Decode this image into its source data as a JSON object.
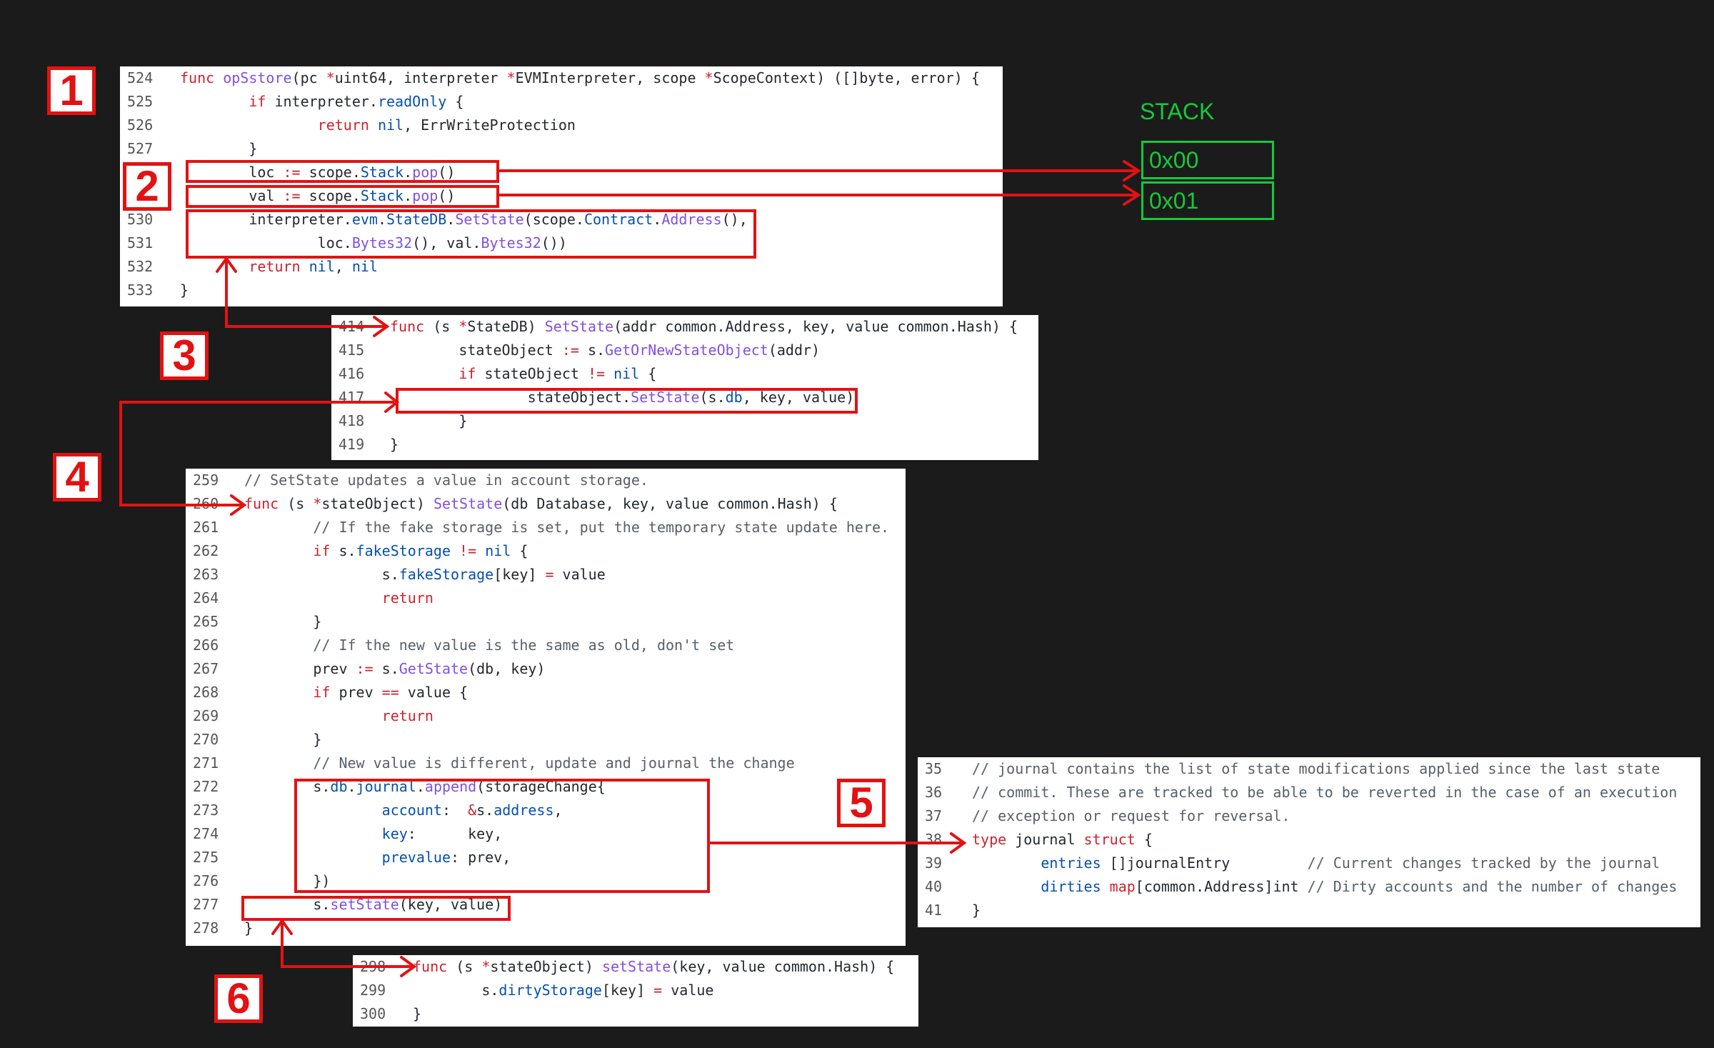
{
  "colors": {
    "background": "#1b1b1b",
    "annotation": "#e31212",
    "stack": "#17c93a"
  },
  "steps": [
    "1",
    "2",
    "3",
    "4",
    "5",
    "6"
  ],
  "stack": {
    "title": "STACK",
    "cells": [
      "0x00",
      "0x01"
    ]
  },
  "panels": [
    {
      "id": "opsstore",
      "lines": [
        {
          "n": "524",
          "t": [
            [
              "kw",
              "func "
            ],
            [
              "fn",
              "opSstore"
            ],
            [
              "",
              "(pc "
            ],
            [
              "kw",
              "*"
            ],
            [
              "",
              "uint64, interpreter "
            ],
            [
              "kw",
              "*"
            ],
            [
              "",
              "EVMInterpreter, scope "
            ],
            [
              "kw",
              "*"
            ],
            [
              "",
              "ScopeContext) ([]byte, error) {"
            ]
          ]
        },
        {
          "n": "525",
          "t": [
            [
              "",
              "        "
            ],
            [
              "kw",
              "if"
            ],
            [
              "",
              " interpreter."
            ],
            [
              "fd",
              "readOnly"
            ],
            [
              "",
              " {"
            ]
          ]
        },
        {
          "n": "526",
          "t": [
            [
              "",
              "                "
            ],
            [
              "kw",
              "return"
            ],
            [
              "",
              " "
            ],
            [
              "fd",
              "nil"
            ],
            [
              "",
              ", ErrWriteProtection"
            ]
          ]
        },
        {
          "n": "527",
          "t": [
            [
              "",
              "        }"
            ]
          ]
        },
        {
          "n": "528",
          "t": [
            [
              "",
              "        loc "
            ],
            [
              "kw",
              ":="
            ],
            [
              "",
              " scope."
            ],
            [
              "fd",
              "Stack"
            ],
            [
              "",
              "."
            ],
            [
              "fn",
              "pop"
            ],
            [
              "",
              "()"
            ]
          ]
        },
        {
          "n": "529",
          "t": [
            [
              "",
              "        val "
            ],
            [
              "kw",
              ":="
            ],
            [
              "",
              " scope."
            ],
            [
              "fd",
              "Stack"
            ],
            [
              "",
              "."
            ],
            [
              "fn",
              "pop"
            ],
            [
              "",
              "()"
            ]
          ]
        },
        {
          "n": "530",
          "t": [
            [
              "",
              "        interpreter."
            ],
            [
              "fd",
              "evm"
            ],
            [
              "",
              "."
            ],
            [
              "fd",
              "StateDB"
            ],
            [
              "",
              "."
            ],
            [
              "fn",
              "SetState"
            ],
            [
              "",
              "(scope."
            ],
            [
              "fd",
              "Contract"
            ],
            [
              "",
              "."
            ],
            [
              "fn",
              "Address"
            ],
            [
              "",
              "(),"
            ]
          ]
        },
        {
          "n": "531",
          "t": [
            [
              "",
              "                loc."
            ],
            [
              "fn",
              "Bytes32"
            ],
            [
              "",
              "(), val."
            ],
            [
              "fn",
              "Bytes32"
            ],
            [
              "",
              "())"
            ]
          ]
        },
        {
          "n": "532",
          "t": [
            [
              "",
              "        "
            ],
            [
              "kw",
              "return"
            ],
            [
              "",
              " "
            ],
            [
              "fd",
              "nil"
            ],
            [
              "",
              ", "
            ],
            [
              "fd",
              "nil"
            ]
          ]
        },
        {
          "n": "533",
          "t": [
            [
              "",
              "}"
            ]
          ]
        }
      ]
    },
    {
      "id": "statedb-setstate",
      "lines": [
        {
          "n": "414",
          "t": [
            [
              "kw",
              "func"
            ],
            [
              "",
              " (s "
            ],
            [
              "kw",
              "*"
            ],
            [
              "",
              "StateDB) "
            ],
            [
              "fn",
              "SetState"
            ],
            [
              "",
              "(addr common.Address, key, value common.Hash) {"
            ]
          ]
        },
        {
          "n": "415",
          "t": [
            [
              "",
              "        stateObject "
            ],
            [
              "kw",
              ":="
            ],
            [
              "",
              " s."
            ],
            [
              "fn",
              "GetOrNewStateObject"
            ],
            [
              "",
              "(addr)"
            ]
          ]
        },
        {
          "n": "416",
          "t": [
            [
              "",
              "        "
            ],
            [
              "kw",
              "if"
            ],
            [
              "",
              " stateObject "
            ],
            [
              "kw",
              "!="
            ],
            [
              "",
              " "
            ],
            [
              "fd",
              "nil"
            ],
            [
              "",
              " {"
            ]
          ]
        },
        {
          "n": "417",
          "t": [
            [
              "",
              "                stateObject."
            ],
            [
              "fn",
              "SetState"
            ],
            [
              "",
              "(s."
            ],
            [
              "fd",
              "db"
            ],
            [
              "",
              ", key, value)"
            ]
          ]
        },
        {
          "n": "418",
          "t": [
            [
              "",
              "        }"
            ]
          ]
        },
        {
          "n": "419",
          "t": [
            [
              "",
              "}"
            ]
          ]
        }
      ]
    },
    {
      "id": "stateobject-setstate",
      "lines": [
        {
          "n": "259",
          "t": [
            [
              "cm",
              "// SetState updates a value in account storage."
            ]
          ]
        },
        {
          "n": "260",
          "t": [
            [
              "kw",
              "func"
            ],
            [
              "",
              " (s "
            ],
            [
              "kw",
              "*"
            ],
            [
              "",
              "stateObject) "
            ],
            [
              "fn",
              "SetState"
            ],
            [
              "",
              "(db Database, key, value common.Hash) {"
            ]
          ]
        },
        {
          "n": "261",
          "t": [
            [
              "",
              "        "
            ],
            [
              "cm",
              "// If the fake storage is set, put the temporary state update here."
            ]
          ]
        },
        {
          "n": "262",
          "t": [
            [
              "",
              "        "
            ],
            [
              "kw",
              "if"
            ],
            [
              "",
              " s."
            ],
            [
              "fd",
              "fakeStorage"
            ],
            [
              "",
              " "
            ],
            [
              "kw",
              "!="
            ],
            [
              "",
              " "
            ],
            [
              "fd",
              "nil"
            ],
            [
              "",
              " {"
            ]
          ]
        },
        {
          "n": "263",
          "t": [
            [
              "",
              "                s."
            ],
            [
              "fd",
              "fakeStorage"
            ],
            [
              "",
              "[key] "
            ],
            [
              "kw",
              "="
            ],
            [
              "",
              " value"
            ]
          ]
        },
        {
          "n": "264",
          "t": [
            [
              "",
              "                "
            ],
            [
              "kw",
              "return"
            ]
          ]
        },
        {
          "n": "265",
          "t": [
            [
              "",
              "        }"
            ]
          ]
        },
        {
          "n": "266",
          "t": [
            [
              "",
              "        "
            ],
            [
              "cm",
              "// If the new value is the same as old, don't set"
            ]
          ]
        },
        {
          "n": "267",
          "t": [
            [
              "",
              "        prev "
            ],
            [
              "kw",
              ":="
            ],
            [
              "",
              " s."
            ],
            [
              "fn",
              "GetState"
            ],
            [
              "",
              "(db, key)"
            ]
          ]
        },
        {
          "n": "268",
          "t": [
            [
              "",
              "        "
            ],
            [
              "kw",
              "if"
            ],
            [
              "",
              " prev "
            ],
            [
              "kw",
              "=="
            ],
            [
              "",
              " value {"
            ]
          ]
        },
        {
          "n": "269",
          "t": [
            [
              "",
              "                "
            ],
            [
              "kw",
              "return"
            ]
          ]
        },
        {
          "n": "270",
          "t": [
            [
              "",
              "        }"
            ]
          ]
        },
        {
          "n": "271",
          "t": [
            [
              "",
              "        "
            ],
            [
              "cm",
              "// New value is different, update and journal the change"
            ]
          ]
        },
        {
          "n": "272",
          "t": [
            [
              "",
              "        s."
            ],
            [
              "fd",
              "db"
            ],
            [
              "",
              "."
            ],
            [
              "fd",
              "journal"
            ],
            [
              "",
              "."
            ],
            [
              "fn",
              "append"
            ],
            [
              "",
              "(storageChange{"
            ]
          ]
        },
        {
          "n": "273",
          "t": [
            [
              "",
              "                "
            ],
            [
              "fd",
              "account"
            ],
            [
              "",
              ":  "
            ],
            [
              "kw",
              "&"
            ],
            [
              "",
              "s."
            ],
            [
              "fd",
              "address"
            ],
            [
              "",
              ","
            ]
          ]
        },
        {
          "n": "274",
          "t": [
            [
              "",
              "                "
            ],
            [
              "fd",
              "key"
            ],
            [
              "",
              ":      key,"
            ]
          ]
        },
        {
          "n": "275",
          "t": [
            [
              "",
              "                "
            ],
            [
              "fd",
              "prevalue"
            ],
            [
              "",
              ": prev,"
            ]
          ]
        },
        {
          "n": "276",
          "t": [
            [
              "",
              "        })"
            ]
          ]
        },
        {
          "n": "277",
          "t": [
            [
              "",
              "        s."
            ],
            [
              "fn",
              "setState"
            ],
            [
              "",
              "(key, value)"
            ]
          ]
        },
        {
          "n": "278",
          "t": [
            [
              "",
              "}"
            ]
          ]
        }
      ]
    },
    {
      "id": "journal-struct",
      "lines": [
        {
          "n": "35",
          "t": [
            [
              "cm",
              "// journal contains the list of state modifications applied since the last state"
            ]
          ]
        },
        {
          "n": "36",
          "t": [
            [
              "cm",
              "// commit. These are tracked to be able to be reverted in the case of an execution"
            ]
          ]
        },
        {
          "n": "37",
          "t": [
            [
              "cm",
              "// exception or request for reversal."
            ]
          ]
        },
        {
          "n": "38",
          "t": [
            [
              "kw",
              "type"
            ],
            [
              "",
              " journal "
            ],
            [
              "kw",
              "struct"
            ],
            [
              "",
              " {"
            ]
          ]
        },
        {
          "n": "39",
          "t": [
            [
              "",
              "        "
            ],
            [
              "fd",
              "entries"
            ],
            [
              "",
              " []journalEntry         "
            ],
            [
              "cm",
              "// Current changes tracked by the journal"
            ]
          ]
        },
        {
          "n": "40",
          "t": [
            [
              "",
              "        "
            ],
            [
              "fd",
              "dirties"
            ],
            [
              "",
              " "
            ],
            [
              "kw",
              "map"
            ],
            [
              "",
              "[common.Address]int "
            ],
            [
              "cm",
              "// Dirty accounts and the number of changes"
            ]
          ]
        },
        {
          "n": "41",
          "t": [
            [
              "",
              "}"
            ]
          ]
        }
      ]
    },
    {
      "id": "stateobject-setstate-private",
      "lines": [
        {
          "n": "298",
          "t": [
            [
              "kw",
              "func"
            ],
            [
              "",
              " (s "
            ],
            [
              "kw",
              "*"
            ],
            [
              "",
              "stateObject) "
            ],
            [
              "fn",
              "setState"
            ],
            [
              "",
              "(key, value common.Hash) {"
            ]
          ]
        },
        {
          "n": "299",
          "t": [
            [
              "",
              "        s."
            ],
            [
              "fd",
              "dirtyStorage"
            ],
            [
              "",
              "[key] "
            ],
            [
              "kw",
              "="
            ],
            [
              "",
              " value"
            ]
          ]
        },
        {
          "n": "300",
          "t": [
            [
              "",
              "}"
            ]
          ]
        }
      ]
    }
  ]
}
